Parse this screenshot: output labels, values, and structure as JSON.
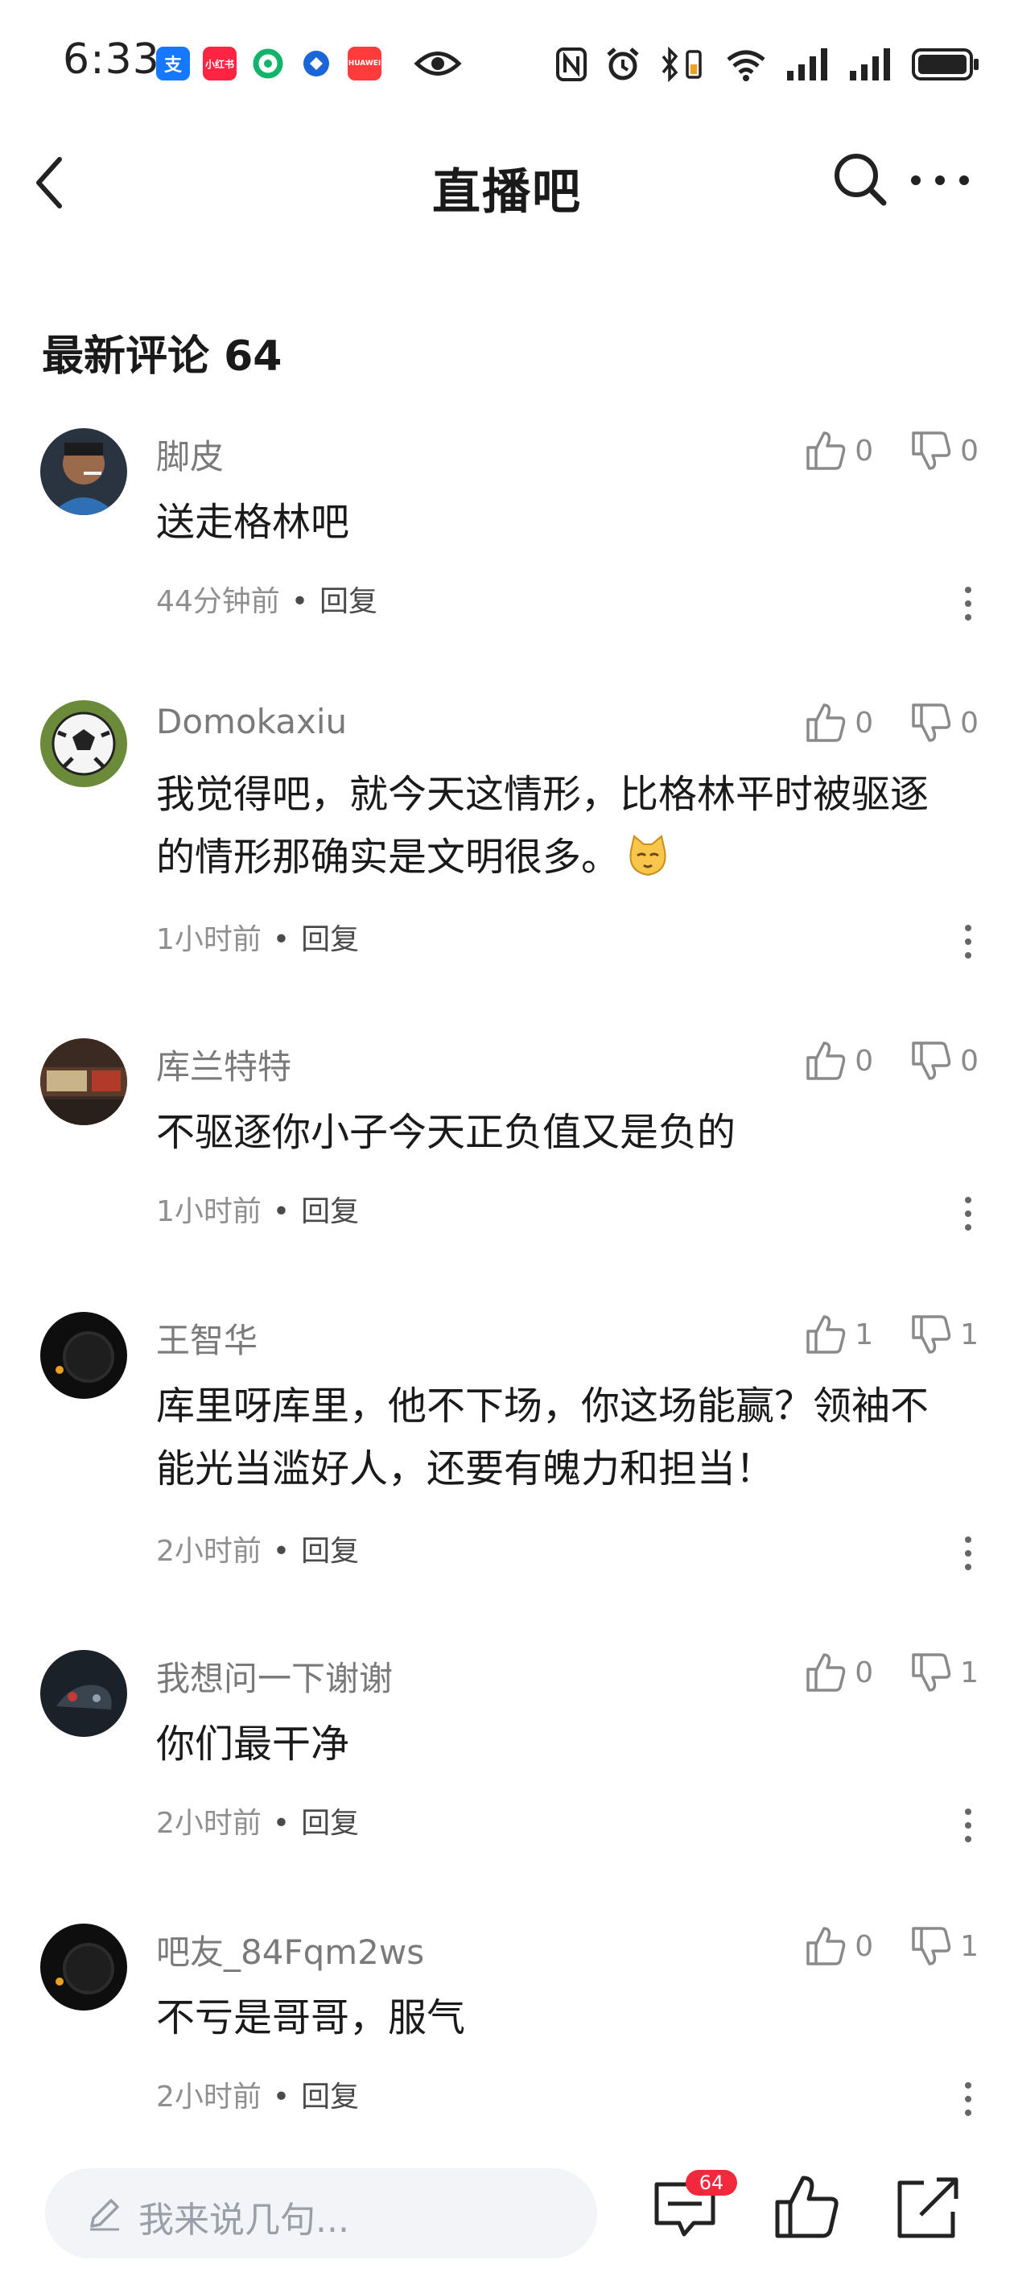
{
  "status_bar": {
    "time": "6:33",
    "apps": [
      {
        "name": "alipay-icon",
        "glyph": "支",
        "color": "#1677ff"
      },
      {
        "name": "xiaohongshu-icon",
        "glyph": "小红书",
        "color": "#ff2442"
      },
      {
        "name": "green-app-icon",
        "glyph": "",
        "color": "#13b36b"
      },
      {
        "name": "blue-app-icon",
        "glyph": "",
        "color": "#1a66d8"
      },
      {
        "name": "huawei-icon",
        "glyph": "HUAWEI",
        "color": "#ff3b3b"
      }
    ]
  },
  "header": {
    "title": "直播吧"
  },
  "comments_section": {
    "title": "最新评论 64"
  },
  "comments": [
    {
      "user": "脚皮",
      "text": "送走格林吧",
      "time": "44分钟前",
      "reply": "回复",
      "likes": "0",
      "dislikes": "0"
    },
    {
      "user": "Domokaxiu",
      "text": "我觉得吧，就今天这情形，比格林平时被驱逐的情形那确实是文明很多。",
      "time": "1小时前",
      "reply": "回复",
      "likes": "0",
      "dislikes": "0"
    },
    {
      "user": "库兰特特",
      "text": "不驱逐你小子今天正负值又是负的",
      "time": "1小时前",
      "reply": "回复",
      "likes": "0",
      "dislikes": "0"
    },
    {
      "user": "王智华",
      "text": "库里呀库里，他不下场，你这场能赢？领袖不能光当滥好人，还要有魄力和担当！",
      "time": "2小时前",
      "reply": "回复",
      "likes": "1",
      "dislikes": "1"
    },
    {
      "user": "我想问一下谢谢",
      "text": "你们最干净",
      "time": "2小时前",
      "reply": "回复",
      "likes": "0",
      "dislikes": "1"
    },
    {
      "user": "吧友_84Fqm2ws",
      "text": "不亏是哥哥，服气",
      "time": "2小时前",
      "reply": "回复",
      "likes": "0",
      "dislikes": "1"
    }
  ],
  "bottom_bar": {
    "input_placeholder": "我来说几句...",
    "comment_count_badge": "64"
  }
}
